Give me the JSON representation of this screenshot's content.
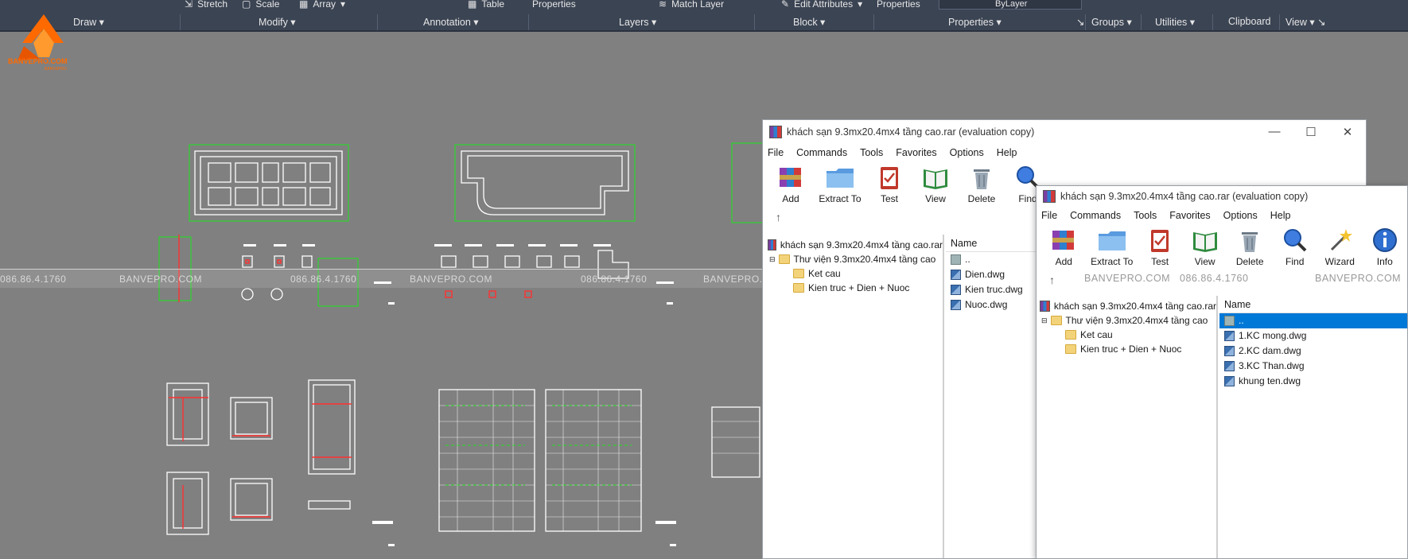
{
  "ribbon": {
    "tools": {
      "stretch": "Stretch",
      "scale": "Scale",
      "array": "Array",
      "table": "Table",
      "properties": "Properties",
      "match_layer": "Match Layer",
      "edit_attributes": "Edit Attributes",
      "properties2": "Properties",
      "bylayer": "ByLayer"
    },
    "groups": [
      "Draw",
      "Modify",
      "Annotation",
      "Layers",
      "Block",
      "Properties",
      "Groups",
      "Utilities",
      "Clipboard",
      "View"
    ]
  },
  "logo": {
    "text": "BANVEPRO.COM",
    "sub": "BANVEPRO"
  },
  "watermarks": {
    "phone": "086.86.4.1760",
    "site": "BANVEPRO.COM"
  },
  "win1": {
    "title": "khách sạn 9.3mx20.4mx4 tầng cao.rar (evaluation copy)",
    "menu": [
      "File",
      "Commands",
      "Tools",
      "Favorites",
      "Options",
      "Help"
    ],
    "toolbar": [
      "Add",
      "Extract To",
      "Test",
      "View",
      "Delete",
      "Find"
    ],
    "tree": {
      "root": "khách sạn 9.3mx20.4mx4 tầng cao.rar",
      "folder": "Thư viện 9.3mx20.4mx4 tầng cao",
      "children": [
        "Ket cau",
        "Kien truc + Dien + Nuoc"
      ]
    },
    "list_header": "Name",
    "files": [
      "..",
      "Dien.dwg",
      "Kien truc.dwg",
      "Nuoc.dwg"
    ]
  },
  "win2": {
    "title": "khách sạn 9.3mx20.4mx4 tầng cao.rar (evaluation copy)",
    "menu": [
      "File",
      "Commands",
      "Tools",
      "Favorites",
      "Options",
      "Help"
    ],
    "toolbar": [
      "Add",
      "Extract To",
      "Test",
      "View",
      "Delete",
      "Find",
      "Wizard",
      "Info"
    ],
    "tree": {
      "root": "khách sạn 9.3mx20.4mx4 tầng cao.rar",
      "folder": "Thư viện 9.3mx20.4mx4 tầng cao",
      "children": [
        "Ket cau",
        "Kien truc + Dien + Nuoc"
      ]
    },
    "list_header": "Name",
    "files": [
      "..",
      "1.KC mong.dwg",
      "2.KC dam.dwg",
      "3.KC Than.dwg",
      "khung ten.dwg"
    ]
  },
  "colors": {
    "ribbon_bg": "#3b4453",
    "canvas_bg": "#808080",
    "selection": "#0078d7",
    "cad_line": "#ffffff",
    "cad_accent": "#00ff00",
    "cad_red": "#ff3030"
  }
}
